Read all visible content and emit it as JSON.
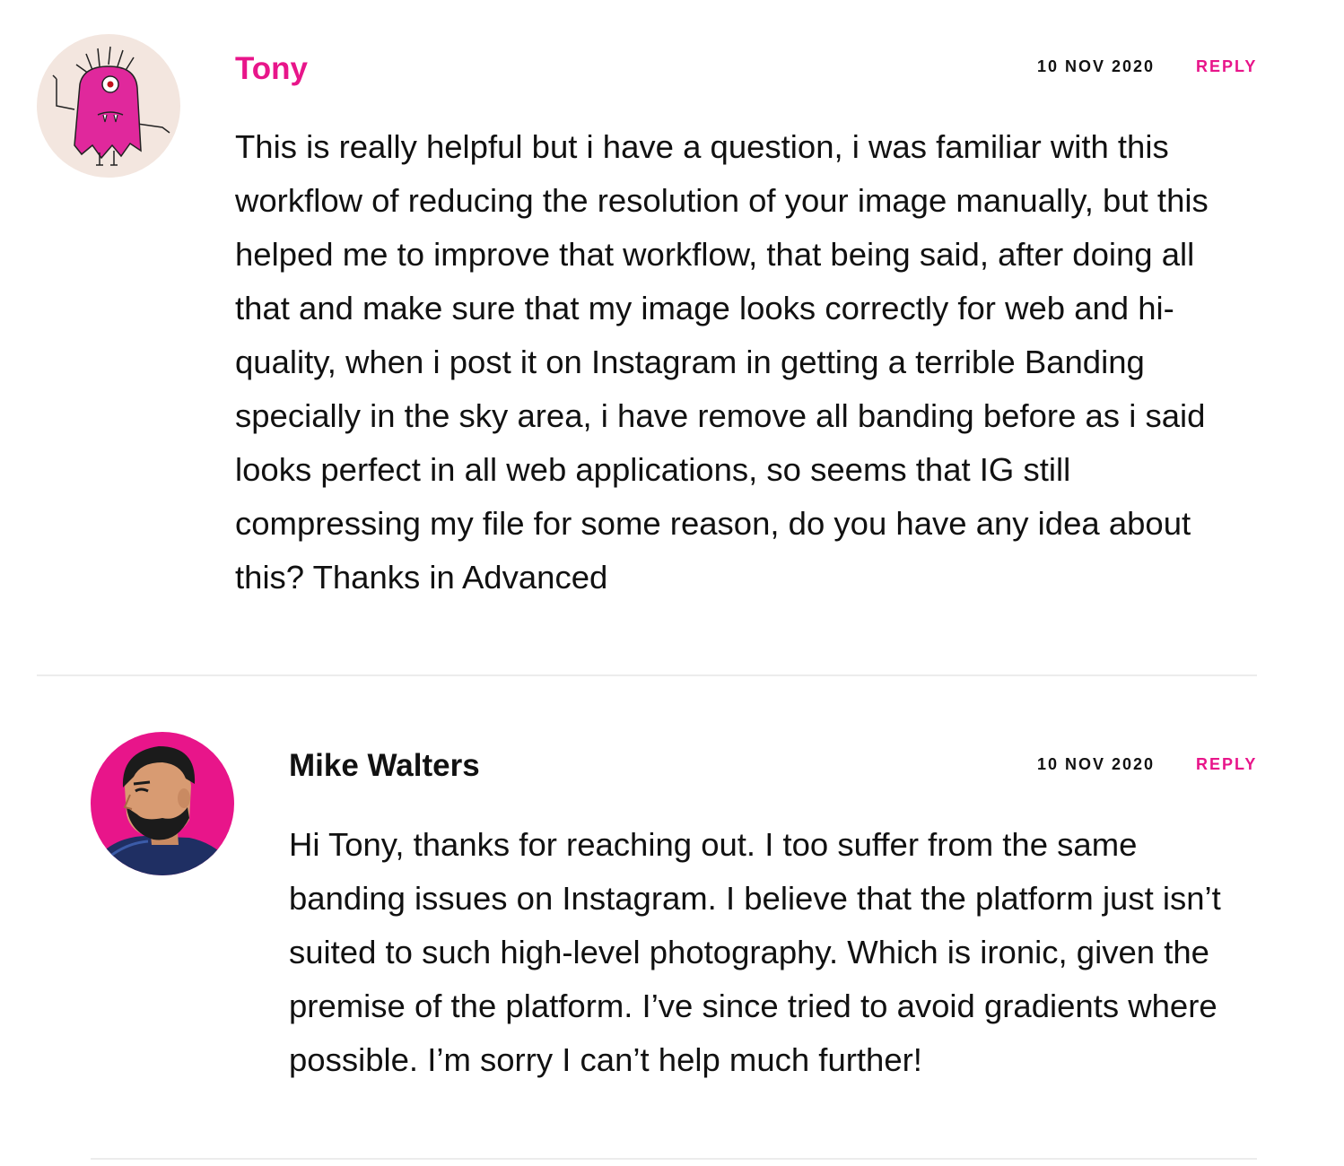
{
  "comments": [
    {
      "author": "Tony",
      "date": "10 NOV 2020",
      "reply_label": "REPLY",
      "avatar": "pink-monster-avatar",
      "text": "This is really helpful but i have a question, i was familiar with this workflow of reducing the resolution of your image manually, but this helped me to improve that workflow, that being said, after doing all that and make sure that my image looks correctly for web and hi-quality, when i post it on Instagram in getting a terrible Banding specially in the sky area, i have remove all banding before as i said looks perfect in all web applications, so seems that IG still compressing my file for some reason, do you have any idea about this? Thanks in Advanced"
    },
    {
      "author": "Mike Walters",
      "date": "10 NOV 2020",
      "reply_label": "REPLY",
      "avatar": "bearded-man-avatar",
      "text": "Hi Tony, thanks for reaching out. I too suffer from the same banding issues on Instagram. I believe that the platform just isn’t suited to such high-level photography. Which is ironic, given the premise of the platform. I’ve since tried to avoid gradients where possible. I’m sorry I can’t help much further!"
    }
  ],
  "colors": {
    "accent": "#e8158a",
    "text": "#111111",
    "divider": "#ececec",
    "avatar_bg_1": "#f3e6df",
    "avatar_bg_2": "#e8158a"
  }
}
